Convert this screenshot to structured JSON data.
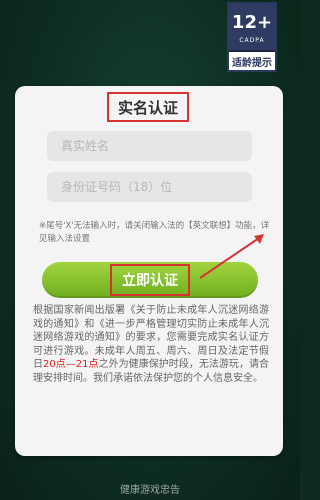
{
  "rating_badge": {
    "age": "12+",
    "org": "CADPA",
    "hint": "适龄提示"
  },
  "dialog": {
    "title": "实名认证",
    "name_field": {
      "placeholder": "真实姓名",
      "value": ""
    },
    "id_field": {
      "placeholder": "身份证号码（18）位",
      "value": ""
    },
    "input_notice": "※尾号'X'无法输入时，请关闭输入法的【英文联想】功能，详见输入法设置",
    "submit_label": "立即认证",
    "policy": {
      "before": "根据国家新闻出版署《关于防止未成年人沉迷网络游戏的通知》和《进一步严格管理切实防止未成年人沉迷网络游戏的通知》的要求，您需要完成实名认证方可进行游戏。未成年人周五、周六、周日及法定节假日",
      "highlight": "20点—21点",
      "after": "之外为健康保护时段，无法游玩，请合理安排时间。我们承诺依法保护您的个人信息安全。"
    }
  },
  "footer": {
    "text": "健康游戏忠告"
  },
  "colors": {
    "accent_red": "#d63333",
    "button_green": "#8cc63f",
    "background": "#0e2f22"
  }
}
